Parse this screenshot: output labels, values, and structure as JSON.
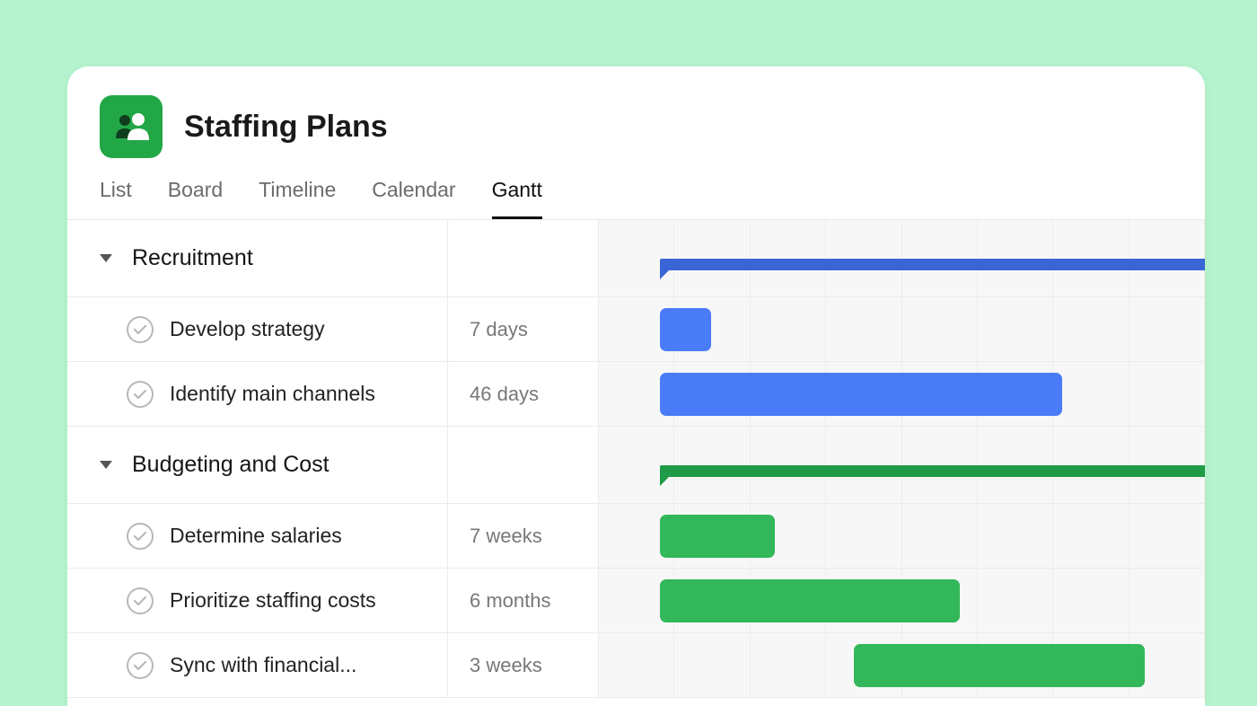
{
  "project": {
    "title": "Staffing Plans"
  },
  "tabs": [
    {
      "label": "List",
      "active": false
    },
    {
      "label": "Board",
      "active": false
    },
    {
      "label": "Timeline",
      "active": false
    },
    {
      "label": "Calendar",
      "active": false
    },
    {
      "label": "Gantt",
      "active": true
    }
  ],
  "colors": {
    "recruitment_group": "#3a65d6",
    "recruitment_task": "#4a7cf7",
    "budget_group": "#1f9a46",
    "budget_task": "#32b85a"
  },
  "groups": [
    {
      "name": "Recruitment",
      "color_key": "recruitment",
      "summary": {
        "left_pct": 10,
        "width_pct": 95
      },
      "tasks": [
        {
          "name": "Develop strategy",
          "duration": "7 days",
          "left_pct": 10,
          "width_pct": 8.5
        },
        {
          "name": "Identify main channels",
          "duration": "46 days",
          "left_pct": 10,
          "width_pct": 66.5
        }
      ]
    },
    {
      "name": "Budgeting and Cost",
      "color_key": "budget",
      "summary": {
        "left_pct": 10,
        "width_pct": 95
      },
      "tasks": [
        {
          "name": "Determine salaries",
          "duration": "7 weeks",
          "left_pct": 10,
          "width_pct": 19
        },
        {
          "name": "Prioritize staffing costs",
          "duration": "6 months",
          "left_pct": 10,
          "width_pct": 49.5
        },
        {
          "name": "Sync with financial...",
          "duration": "3 weeks",
          "left_pct": 42,
          "width_pct": 48
        }
      ]
    }
  ],
  "grid_columns": 8
}
